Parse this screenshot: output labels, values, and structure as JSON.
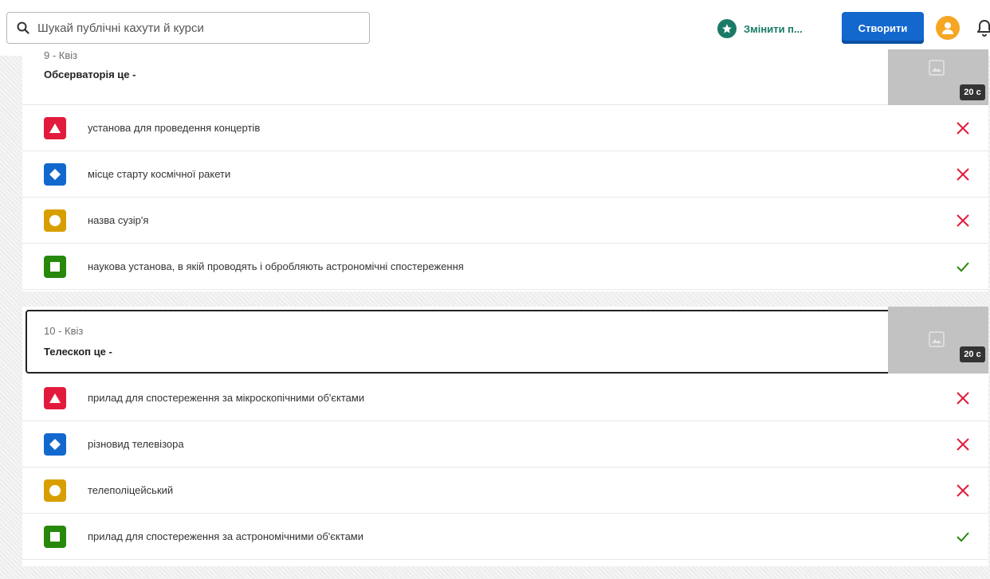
{
  "header": {
    "search_placeholder": "Шукай публічні кахути й курси",
    "upgrade_label": "Змінити п...",
    "create_label": "Створити"
  },
  "colors": {
    "red": "#e21b3c",
    "blue": "#1368ce",
    "yellow": "#d89e00",
    "green": "#26890c",
    "wrong": "#e21b3c",
    "correct": "#26890c"
  },
  "questions": [
    {
      "type_label": "9 - Квіз",
      "title": "Обсерваторія це -",
      "time": "20 с",
      "answers": [
        {
          "shape": "triangle-icon",
          "text": "установа для проведення концертів",
          "correct": false
        },
        {
          "shape": "diamond-icon",
          "text": "місце старту космічної ракети",
          "correct": false
        },
        {
          "shape": "circle-icon",
          "text": "назва сузір'я",
          "correct": false
        },
        {
          "shape": "square-icon",
          "text": "наукова установа, в якій проводять і обробляють астрономічні спостереження",
          "correct": true
        }
      ]
    },
    {
      "type_label": "10 - Квіз",
      "title": "Телескоп це -",
      "time": "20 с",
      "answers": [
        {
          "shape": "triangle-icon",
          "text": "прилад для спостереження за мікроскопічними об'єктами",
          "correct": false
        },
        {
          "shape": "diamond-icon",
          "text": "різновид телевізора",
          "correct": false
        },
        {
          "shape": "circle-icon",
          "text": "телеполіцейський",
          "correct": false
        },
        {
          "shape": "square-icon",
          "text": "прилад для спостереження за астрономічними об'єктами",
          "correct": true
        }
      ]
    }
  ]
}
